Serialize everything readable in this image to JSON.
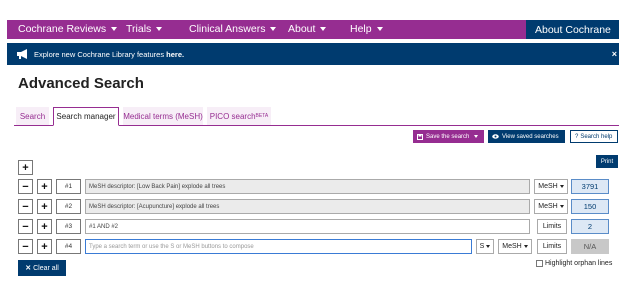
{
  "topnav": {
    "items": [
      {
        "label": "Cochrane Reviews"
      },
      {
        "label": "Trials"
      },
      {
        "label": "Clinical Answers"
      },
      {
        "label": "About"
      },
      {
        "label": "Help"
      }
    ],
    "about_cochrane": "About Cochrane"
  },
  "banner": {
    "text": "Explore new Cochrane Library features ",
    "link": "here.",
    "close": "×"
  },
  "page_title": "Advanced Search",
  "tabs": [
    {
      "label": "Search",
      "active": false
    },
    {
      "label": "Search manager",
      "active": true
    },
    {
      "label": "Medical terms (MeSH)",
      "active": false
    },
    {
      "label": "PICO search",
      "sup": "BETA",
      "active": false
    }
  ],
  "toolbar": {
    "save_label": "Save the search",
    "view_label": "View saved searches",
    "help_label": "Search help",
    "print_label": "Print",
    "add_row": "+"
  },
  "rows": [
    {
      "num": "#1",
      "query": "MeSH descriptor: [Low Back Pain] explode all trees",
      "type": "MeSH",
      "count": "3791"
    },
    {
      "num": "#2",
      "query": "MeSH descriptor: [Acupuncture] explode all trees",
      "type": "MeSH",
      "count": "150"
    },
    {
      "num": "#3",
      "query": "#1 AND #2",
      "type": "Limits",
      "count": "2"
    }
  ],
  "new_row": {
    "num": "#4",
    "placeholder": "Type a search term or use the S or MeSH buttons to compose",
    "s_label": "S",
    "mesh_label": "MeSH",
    "limits_label": "Limits",
    "count": "N/A"
  },
  "footer": {
    "clear_all": "Clear all",
    "highlight_orphan": "Highlight orphan lines"
  },
  "colors": {
    "purple": "#962d91",
    "navy": "#003b6f"
  }
}
